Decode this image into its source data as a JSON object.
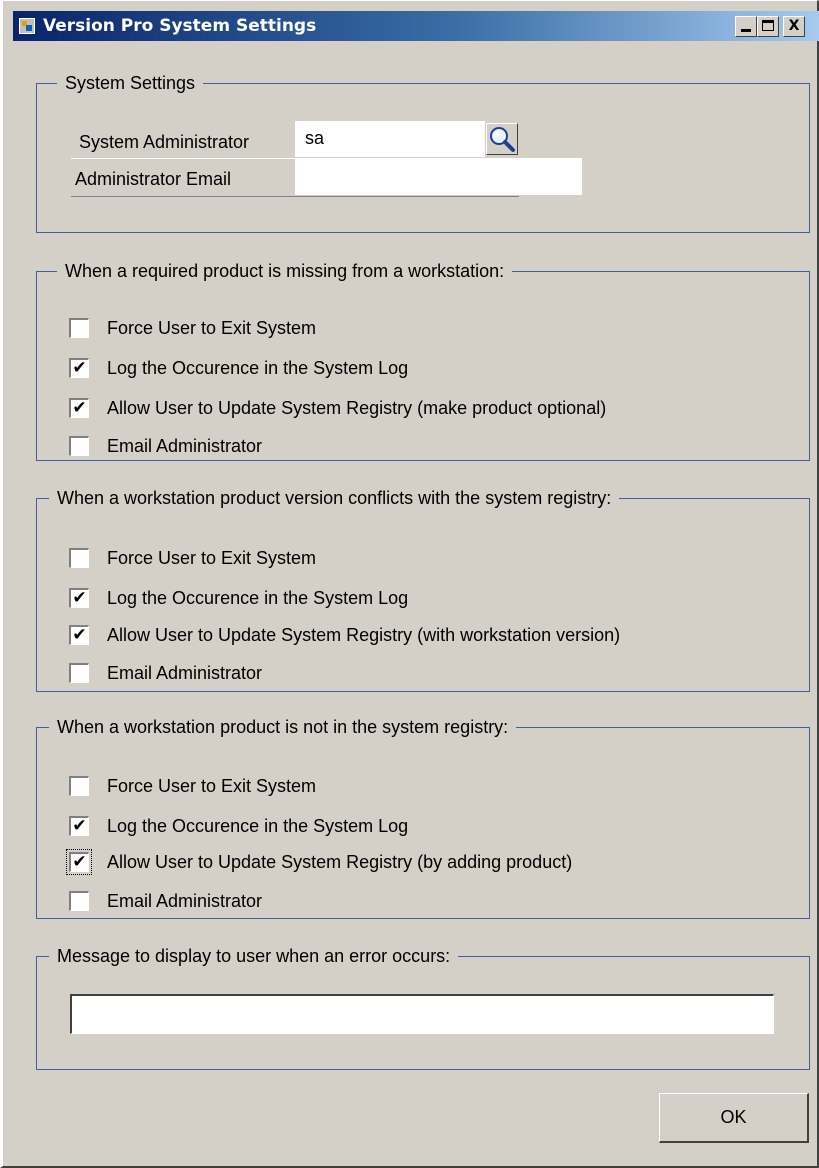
{
  "window": {
    "title": "Version Pro System Settings",
    "controls": {
      "minimize": "_",
      "close": "X"
    }
  },
  "system_settings": {
    "title": "System Settings",
    "admin_label": "System Administrator",
    "admin_value": "sa",
    "email_label": "Administrator Email",
    "email_value": "",
    "lookup_icon": "magnifier-icon"
  },
  "groups": [
    {
      "title": "When a required product is missing from a workstation:",
      "options": [
        {
          "label": "Force User to Exit System",
          "checked": false
        },
        {
          "label": "Log the Occurence in the System Log",
          "checked": true
        },
        {
          "label": "Allow User to Update System Registry (make product optional)",
          "checked": true
        },
        {
          "label": "Email Administrator",
          "checked": false
        }
      ]
    },
    {
      "title": "When a workstation product version conflicts with the system registry:",
      "options": [
        {
          "label": "Force User to Exit System",
          "checked": false
        },
        {
          "label": "Log the Occurence in the System Log",
          "checked": true
        },
        {
          "label": "Allow User to Update System Registry (with workstation version)",
          "checked": true
        },
        {
          "label": "Email Administrator",
          "checked": false
        }
      ]
    },
    {
      "title": "When a workstation product is not in the system registry:",
      "options": [
        {
          "label": "Force User to Exit System",
          "checked": false
        },
        {
          "label": "Log the Occurence in the System Log",
          "checked": true
        },
        {
          "label": "Allow User to Update System Registry (by adding product)",
          "checked": true
        },
        {
          "label": "Email Administrator",
          "checked": false
        }
      ]
    }
  ],
  "error_message": {
    "title": "Message to display to user when an error occurs:",
    "value": ""
  },
  "buttons": {
    "ok": "OK"
  },
  "colors": {
    "title_gradient_start": "#0a246a",
    "title_gradient_end": "#a6caf0",
    "group_border": "#40619c",
    "face": "#d4d0c8"
  }
}
